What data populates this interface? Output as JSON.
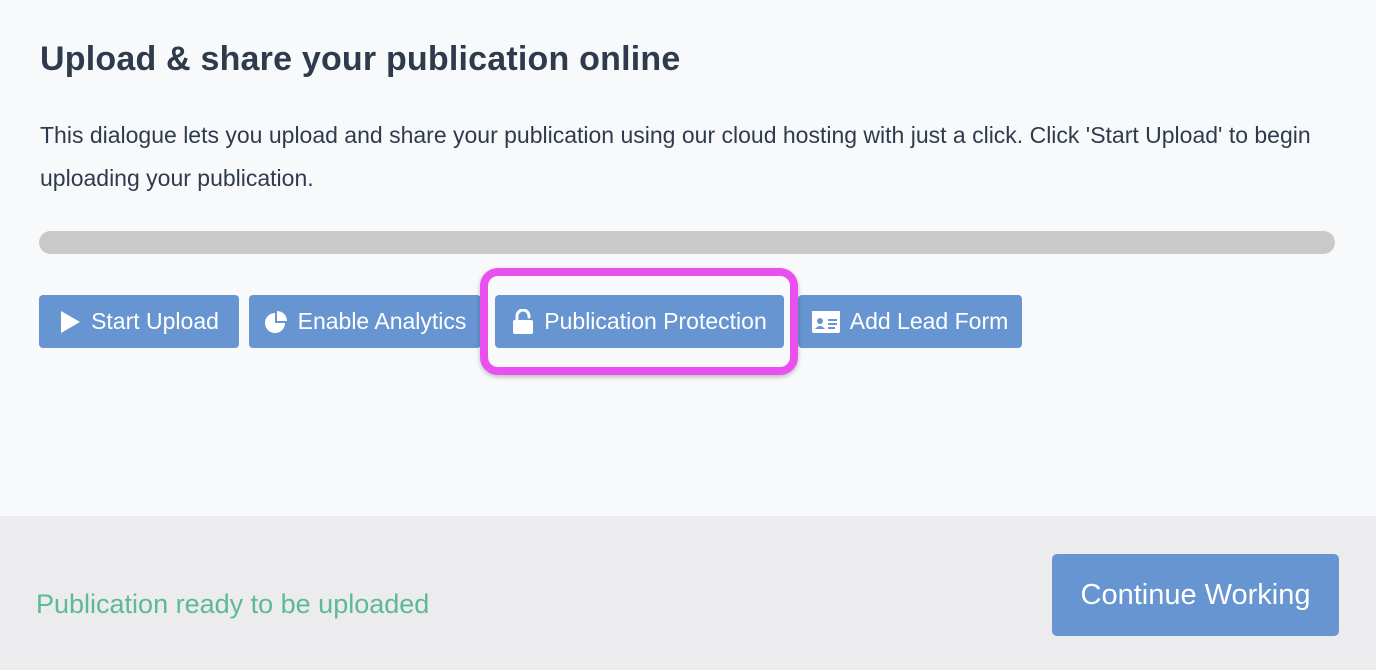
{
  "dialog": {
    "title": "Upload & share your publication online",
    "description": "This dialogue lets you upload and share your publication using our cloud hosting with just a click. Click 'Start Upload' to begin uploading your publication.",
    "progress_percent": 0
  },
  "actions": {
    "start_upload": {
      "label": "Start Upload",
      "icon": "play-icon"
    },
    "enable_analytics": {
      "label": "Enable Analytics",
      "icon": "pie-chart-icon"
    },
    "publication_protection": {
      "label": "Publication Protection",
      "icon": "unlock-icon",
      "highlighted": true
    },
    "add_lead_form": {
      "label": "Add Lead Form",
      "icon": "id-card-icon"
    }
  },
  "footer": {
    "status": "Publication ready to be uploaded",
    "continue_label": "Continue Working"
  },
  "colors": {
    "button": "#6695d1",
    "status_text": "#5dba94",
    "highlight": "#ea4ff0",
    "title_text": "#2f3b4d"
  }
}
